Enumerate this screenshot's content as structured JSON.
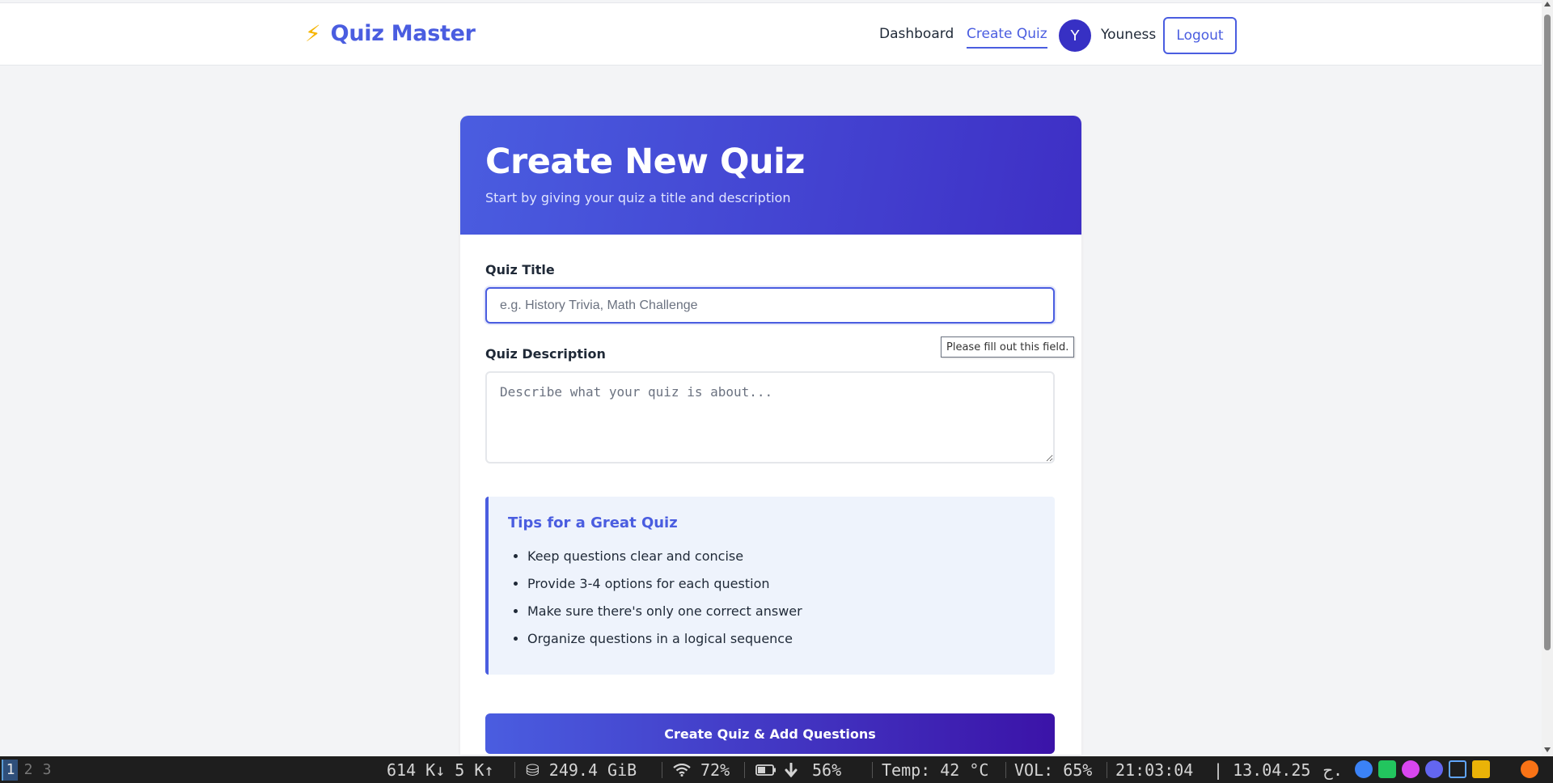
{
  "nav": {
    "brand_icon": "⚡",
    "brand_name": "Quiz Master",
    "links": [
      "Dashboard",
      "Create Quiz"
    ],
    "active_link": "Create Quiz",
    "avatar_initial": "Y",
    "username": "Youness",
    "logout_label": "Logout"
  },
  "card": {
    "title": "Create New Quiz",
    "subtitle": "Start by giving your quiz a title and description"
  },
  "form": {
    "title_label": "Quiz Title",
    "title_placeholder": "e.g. History Trivia, Math Challenge",
    "title_value": "",
    "desc_label": "Quiz Description",
    "desc_placeholder": "Describe what your quiz is about...",
    "desc_value": "",
    "validation_tooltip": "Please fill out this field."
  },
  "tips": {
    "title": "Tips for a Great Quiz",
    "items": [
      "Keep questions clear and concise",
      "Provide 3-4 options for each question",
      "Make sure there's only one correct answer",
      "Organize questions in a logical sequence"
    ]
  },
  "submit_label": "Create Quiz & Add Questions",
  "taskbar": {
    "workspaces": [
      "1",
      "2",
      "3"
    ],
    "active_workspace": "1",
    "net": "614 K↓ 5 K↑",
    "disk": "⛁ 249.4 GiB",
    "wifi": "72%",
    "battery": "56%",
    "temp": "Temp: 42 °C",
    "volume": "VOL: 65%",
    "time": "21:03:04",
    "date": "| 13.04.25",
    "layout": "ح."
  },
  "colors": {
    "accent": "#4a5de0",
    "header_gradient_end": "#3e2fc5",
    "button_gradient_end": "#3b13a8",
    "bolt": "#f6b400",
    "tips_bg": "#eef3fc"
  }
}
